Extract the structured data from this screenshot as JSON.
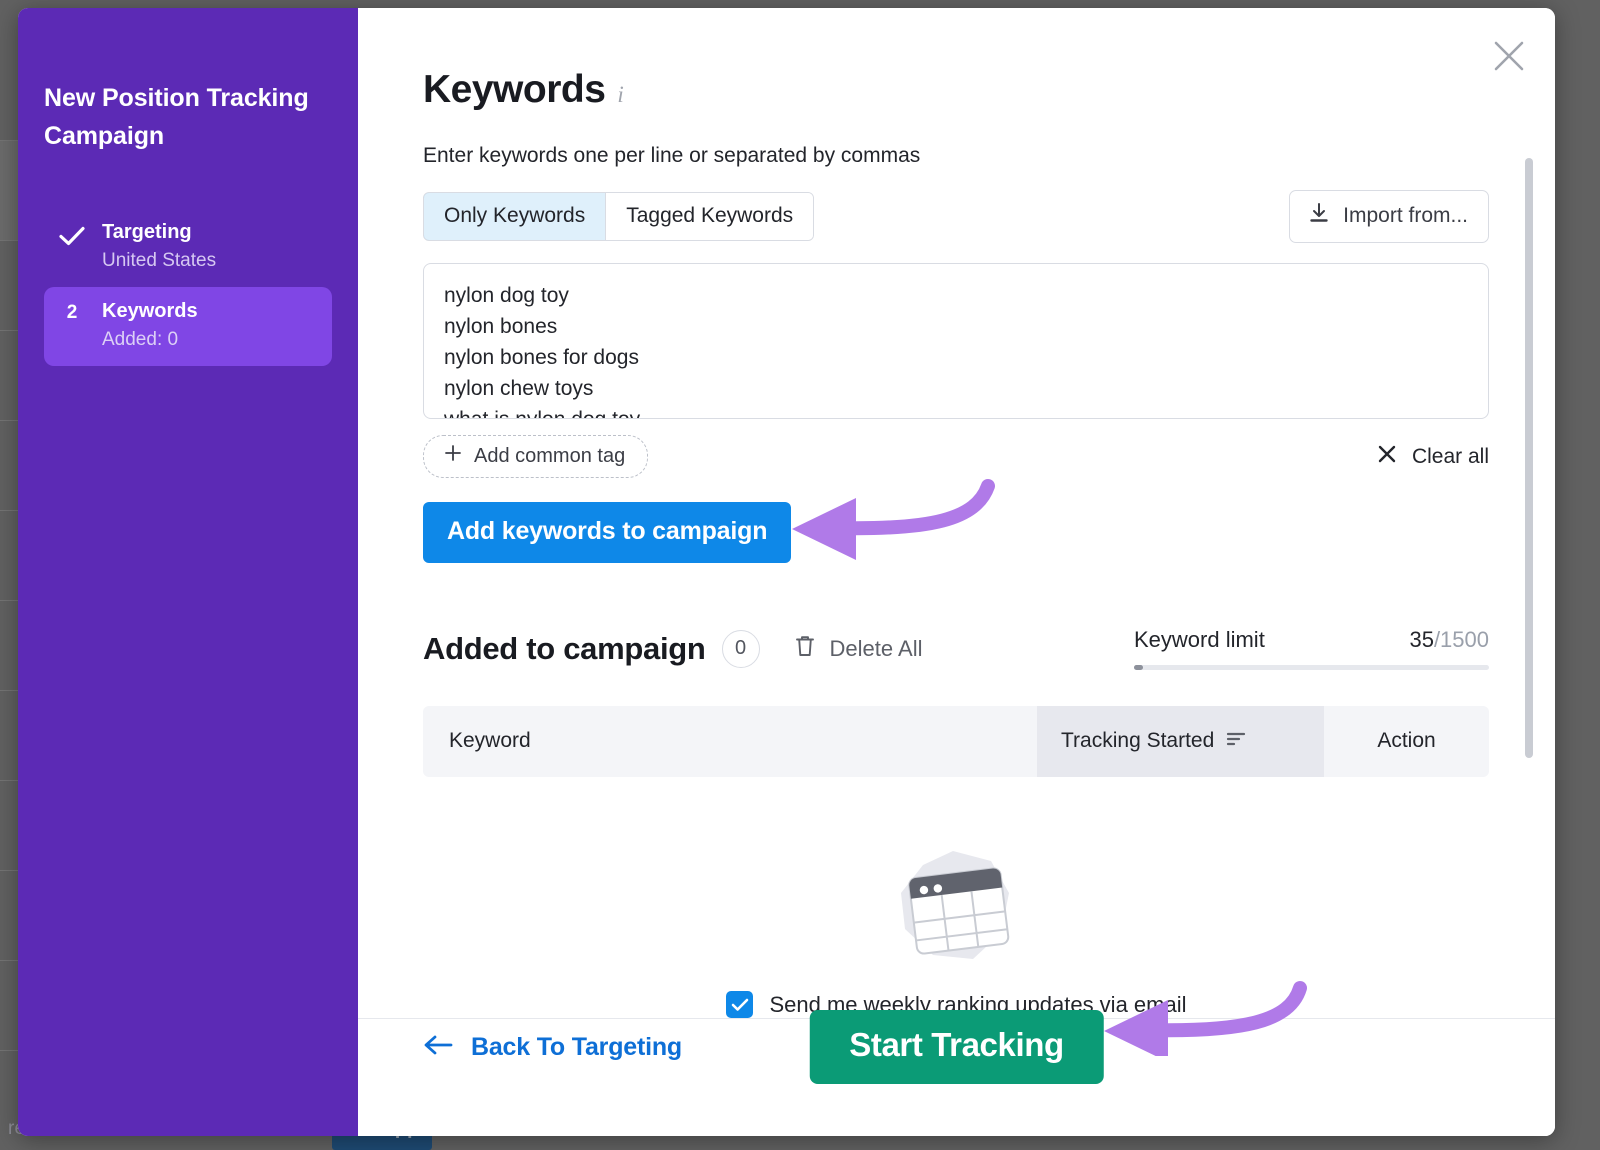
{
  "background": {
    "site_label": "realtor.com",
    "button_label": "Get app"
  },
  "sidebar": {
    "title": "New Position Tracking Campaign",
    "steps": [
      {
        "marker": "check-icon",
        "name": "Targeting",
        "sub": "United States",
        "active": false
      },
      {
        "marker": "2",
        "name": "Keywords",
        "sub": "Added: 0",
        "active": true
      }
    ]
  },
  "header": {
    "title": "Keywords",
    "info_icon": "info-italic-icon",
    "close_icon": "close-icon"
  },
  "keywords_section": {
    "hint": "Enter keywords one per line or separated by commas",
    "tabs": [
      {
        "label": "Only Keywords",
        "selected": true
      },
      {
        "label": "Tagged Keywords",
        "selected": false
      }
    ],
    "import_label": "Import from...",
    "import_icon": "download-icon",
    "textarea_lines": [
      "nylon dog toy",
      "nylon bones",
      "nylon bones for dogs",
      "nylon chew toys",
      "what is nylon dog toy"
    ],
    "add_common_tag_label": "Add common tag",
    "add_common_tag_icon": "plus-icon",
    "clear_all_label": "Clear all",
    "clear_all_icon": "close-x-icon",
    "add_keywords_button": "Add keywords to campaign"
  },
  "added_section": {
    "title": "Added to campaign",
    "count": "0",
    "delete_all_label": "Delete All",
    "delete_all_icon": "trash-icon",
    "limit_label": "Keyword limit",
    "limit_used": "35",
    "limit_total": "/1500",
    "table_headers": {
      "keyword": "Keyword",
      "tracking_started": "Tracking Started",
      "sort_icon": "sort-icon",
      "action": "Action"
    },
    "empty_illustration": "calendar-table-illustration"
  },
  "footer": {
    "checkbox_label": "Send me weekly ranking updates via email",
    "checkbox_checked": true,
    "back_label": "Back To Targeting",
    "back_icon": "arrow-left-icon",
    "start_label": "Start Tracking"
  },
  "annotations": {
    "arrow_color": "#b07ae8",
    "arrow_1_target": "Add keywords to campaign",
    "arrow_2_target": "Start Tracking"
  },
  "colors": {
    "sidebar": "#5c2ab5",
    "sidebar_active": "#8046e5",
    "primary_blue": "#0e88e8",
    "green": "#0b9b76",
    "link_blue": "#0e6fd6"
  }
}
